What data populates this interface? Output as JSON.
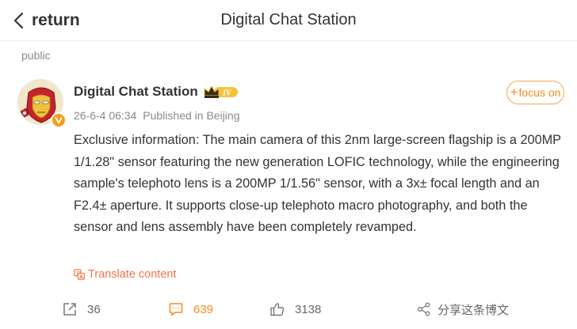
{
  "nav": {
    "back_label": "return",
    "title": "Digital Chat Station"
  },
  "section_label": "public",
  "post": {
    "author": "Digital Chat Station",
    "level_badge_text": "IV",
    "timestamp": "26-6-4 06:34",
    "location": "Published in Beijing",
    "follow_label": "focus on",
    "follow_plus": "+",
    "body": "Exclusive information: The main camera of this 2nm large-screen flagship is a 200MP 1/1.28\" sensor featuring the new generation LOFIC technology, while the engineering sample's telephoto lens is a 200MP 1/1.56\" sensor, with a 3x± focal length and an F2.4± aperture. It supports close-up telephoto macro photography, and both the sensor and lens assembly have been completely revamped.",
    "translate_label": "Translate content"
  },
  "actions": {
    "repost_count": "36",
    "comment_count": "639",
    "like_count": "3138",
    "share_label": "分享这条博文"
  },
  "colors": {
    "accent_orange": "#f58d1e",
    "translate_red": "#f1754b",
    "muted_text": "#8a8a8a",
    "primary_text": "#333333"
  },
  "icons": {
    "back": "chevron-left-icon",
    "verified": "verified-v-icon",
    "level": "crown-level-icon",
    "translate": "translate-icon",
    "repost": "repost-icon",
    "comment": "comment-icon",
    "like": "thumbs-up-icon",
    "share": "share-icon"
  }
}
